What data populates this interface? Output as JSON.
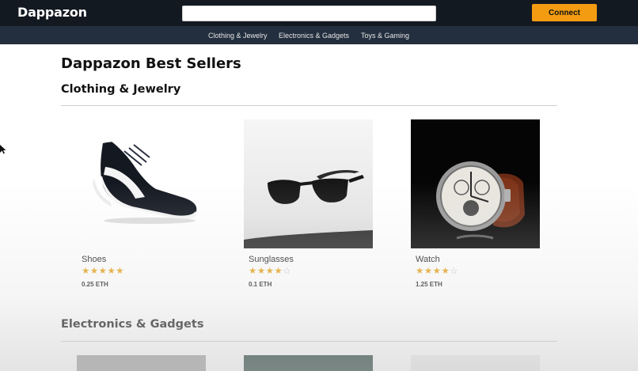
{
  "header": {
    "logo": "Dappazon",
    "search": {
      "value": "",
      "placeholder": ""
    },
    "connect_label": "Connect",
    "accent_color": "#f39c12",
    "background_color": "#131921"
  },
  "subnav": {
    "items": [
      {
        "label": "Clothing & Jewelry"
      },
      {
        "label": "Electronics & Gadgets"
      },
      {
        "label": "Toys & Gaming"
      }
    ]
  },
  "main": {
    "title": "Dappazon Best Sellers",
    "sections": [
      {
        "title": "Clothing & Jewelry",
        "products": [
          {
            "name": "Shoes",
            "rating": 5,
            "rating_max": 5,
            "price": "0.25 ETH",
            "image_icon": "sneaker-image"
          },
          {
            "name": "Sunglasses",
            "rating": 4,
            "rating_max": 5,
            "price": "0.1 ETH",
            "image_icon": "sunglasses-image"
          },
          {
            "name": "Watch",
            "rating": 4,
            "rating_max": 5,
            "price": "1.25 ETH",
            "image_icon": "watch-image"
          }
        ]
      },
      {
        "title": "Electronics & Gadgets",
        "products": []
      }
    ]
  },
  "star_color": "#e8a21a"
}
